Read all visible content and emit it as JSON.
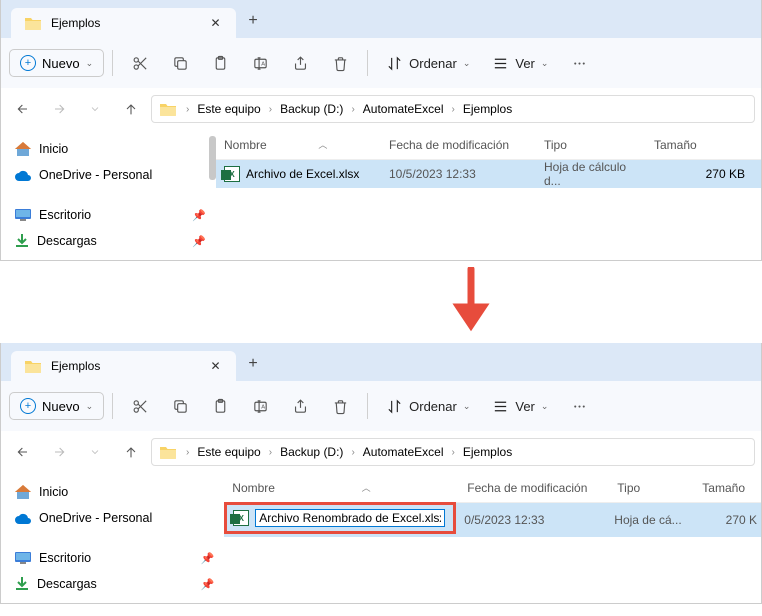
{
  "tab": {
    "title": "Ejemplos"
  },
  "toolbar": {
    "new_label": "Nuevo",
    "sort_label": "Ordenar",
    "view_label": "Ver"
  },
  "breadcrumbs": [
    "Este equipo",
    "Backup (D:)",
    "AutomateExcel",
    "Ejemplos"
  ],
  "sidebar": {
    "home": "Inicio",
    "onedrive": "OneDrive - Personal",
    "desktop": "Escritorio",
    "downloads": "Descargas"
  },
  "columns": {
    "name": "Nombre",
    "date": "Fecha de modificación",
    "type": "Tipo",
    "size": "Tamaño"
  },
  "file1": {
    "name": "Archivo de Excel.xlsx",
    "date": "10/5/2023 12:33",
    "type": "Hoja de cálculo d...",
    "size": "270 KB"
  },
  "file2": {
    "rename_value": "Archivo Renombrado de Excel.xlsx",
    "date_partial": "0/5/2023 12:33",
    "type_short": "Hoja de cá...",
    "size_short": "270 K"
  }
}
